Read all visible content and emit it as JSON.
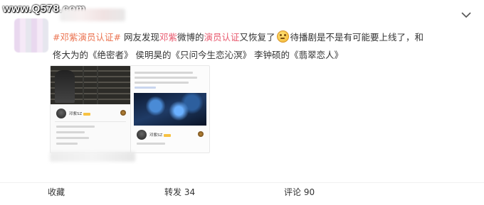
{
  "watermark": "www.Q578.com",
  "post": {
    "tag": "#邓紫演员认证#",
    "line1": [
      {
        "t": "网友发现",
        "c": "plain"
      },
      {
        "t": "邓紫",
        "c": "hl"
      },
      {
        "t": "微博的",
        "c": "plain"
      },
      {
        "t": "演员认证",
        "c": "hl"
      },
      {
        "t": "又恢复了",
        "c": "plain"
      },
      {
        "t": "EMOJI",
        "c": "emoji"
      },
      {
        "t": "待播剧是不是有可能要上线了，和",
        "c": "plain"
      }
    ],
    "line2": "佟大为的《绝密者》 侯明昊的《只问今生恋沁溟》 李钟硕的《翡翠恋人》"
  },
  "thumbs": [
    {
      "name": "邓紫SZ"
    },
    {
      "name": "邓紫SZ"
    }
  ],
  "actions": {
    "collect": "收藏",
    "repost": "转发 34",
    "comment": "评论 90"
  },
  "icons": {
    "more": "chevron-down-icon",
    "emoji": "smile-emoji-icon"
  },
  "colors": {
    "tag": "#eb7350",
    "highlight": "#e8596e"
  }
}
